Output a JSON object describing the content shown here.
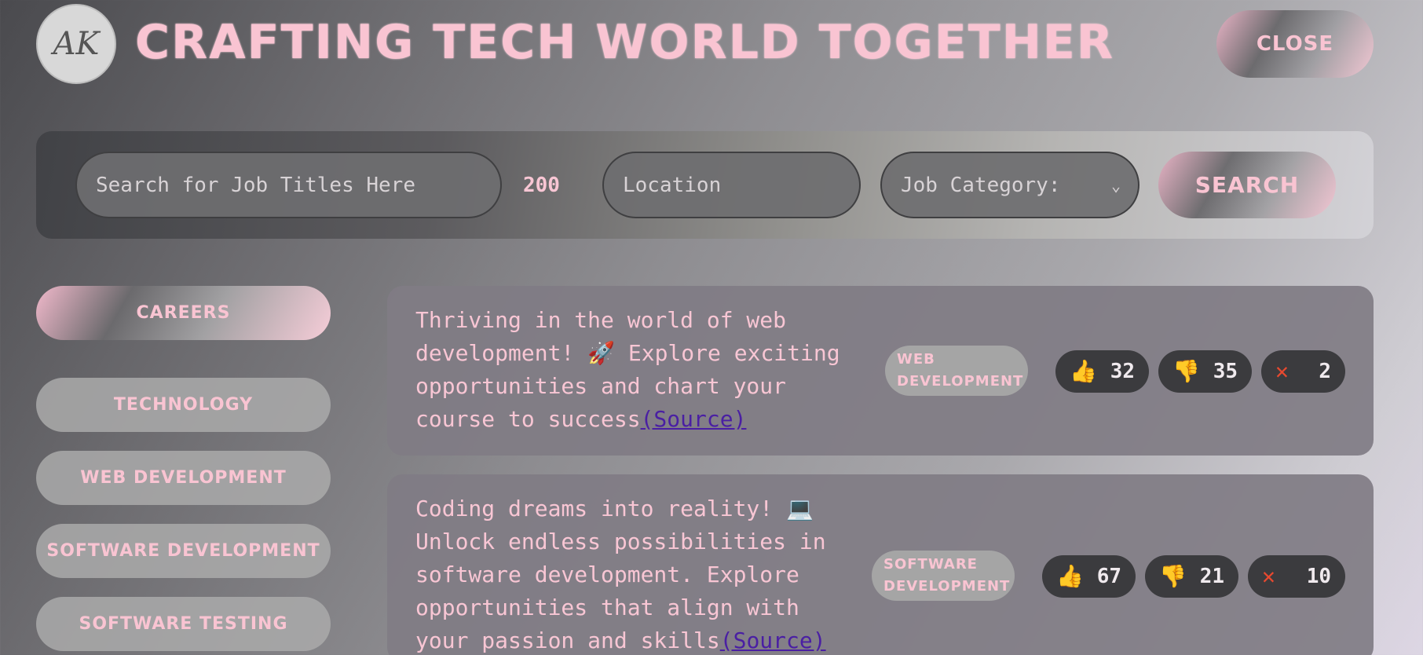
{
  "header": {
    "logo_text": "AK",
    "title": "CRAFTING TECH WORLD TOGETHER",
    "close_label": "CLOSE"
  },
  "search": {
    "title_placeholder": "Search for Job Titles Here",
    "count": "200",
    "location_placeholder": "Location",
    "category_label": "Job Category:",
    "search_label": "SEARCH"
  },
  "sidebar": {
    "items": [
      {
        "label": "CAREERS",
        "active": true
      },
      {
        "label": "TECHNOLOGY"
      },
      {
        "label": "WEB DEVELOPMENT"
      },
      {
        "label": "SOFTWARE DEVELOPMENT"
      },
      {
        "label": "SOFTWARE TESTING"
      }
    ]
  },
  "posts": [
    {
      "lines": [
        "Thriving in the world of web",
        "development! 🚀 Explore exciting",
        "opportunities and chart your",
        "course to success"
      ],
      "source": "(Source)",
      "tag": [
        "WEB",
        "DEVELOPMENT"
      ],
      "likes": "32",
      "dislikes": "35",
      "removes": "2"
    },
    {
      "lines": [
        "Coding dreams into reality! 💻",
        "Unlock endless possibilities in",
        "software development. Explore",
        "opportunities that align with",
        "your passion and skills"
      ],
      "source": "(Source)",
      "tag": [
        "SOFTWARE",
        "DEVELOPMENT"
      ],
      "likes": "67",
      "dislikes": "21",
      "removes": "10"
    }
  ],
  "icons": {
    "like": "thumbs-up-icon",
    "dislike": "thumbs-down-icon",
    "remove": "x-icon",
    "chevron": "chevron-down-icon"
  },
  "colors": {
    "accent_pink": "#f9c4d2",
    "link": "#4a1fa3",
    "stat_bg": "#3b3b3e"
  }
}
